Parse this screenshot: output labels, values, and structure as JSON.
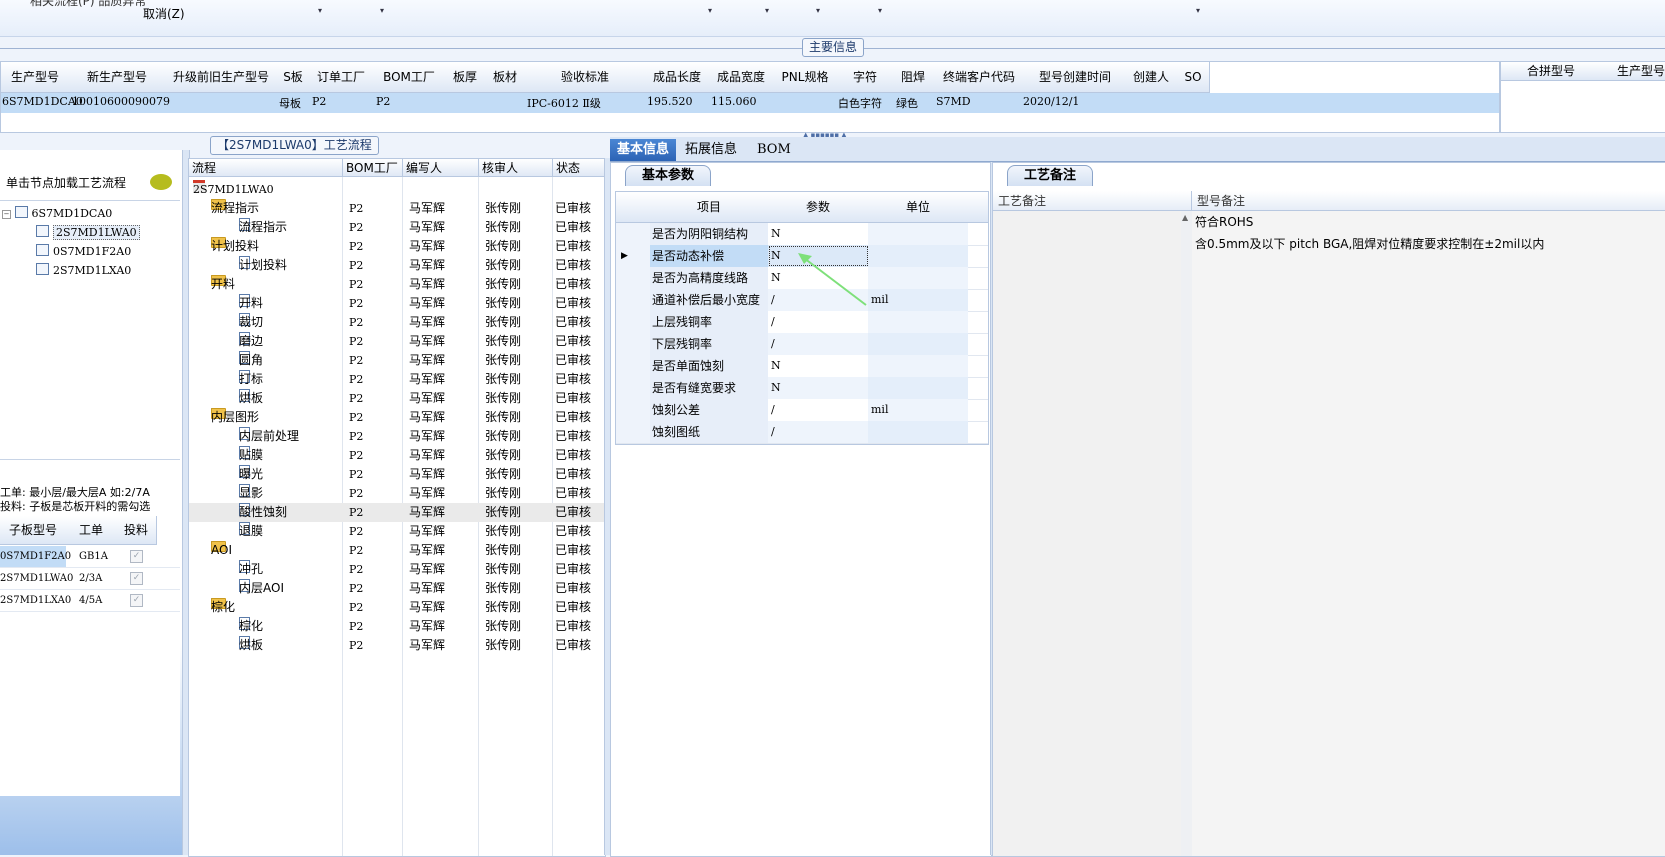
{
  "toolbar": {
    "cut_label": "相关流程(P)  品质异常",
    "cancel_label": "取消(Z)",
    "dropdown_glyph": "▾"
  },
  "main_info": {
    "title": "主要信息",
    "columns": [
      "生产型号",
      "新生产型号",
      "升级前旧生产型号",
      "S板",
      "订单工厂",
      "BOM工厂",
      "板厚",
      "板材",
      "验收标准",
      "成品长度",
      "成品宽度",
      "PNL规格",
      "字符",
      "阻焊",
      "终端客户代码",
      "型号创建时间",
      "创建人",
      "SO"
    ],
    "row": {
      "production_model": "6S7MD1DCA0",
      "new_production_model": "10010600090079",
      "old_production_model": "",
      "s_board": "母板",
      "order_factory": "P2",
      "bom_factory": "P2",
      "thickness": "",
      "material": "",
      "acceptance_standard": "IPC-6012 Ⅱ级",
      "length": "195.520",
      "width": "115.060",
      "pnl_spec": "",
      "character": "白色字符",
      "solder_mask": "绿色",
      "customer_code": "S7MD",
      "create_time": "2020/12/1",
      "creator": "",
      "so": ""
    },
    "merge_columns": [
      "合拼型号",
      "生产型号"
    ]
  },
  "left_panel": {
    "hint": "单击节点加载工艺流程",
    "tree": [
      {
        "label": "6S7MD1DCA0",
        "level": 0
      },
      {
        "label": "2S7MD1LWA0",
        "level": 1,
        "selected": true
      },
      {
        "label": "0S7MD1F2A0",
        "level": 1
      },
      {
        "label": "2S7MD1LXA0",
        "level": 1
      }
    ],
    "note_line1": "工单: 最小层/最大层A 如:2/7A",
    "note_line2": "投料: 子板是芯板开料的需勾选",
    "sub_columns": [
      "子板型号",
      "工单",
      "投料"
    ],
    "sub_rows": [
      {
        "model": "0S7MD1F2A0",
        "order": "GB1A",
        "feed": true
      },
      {
        "model": "2S7MD1LWA0",
        "order": "2/3A",
        "feed": true
      },
      {
        "model": "2S7MD1LXA0",
        "order": "4/5A",
        "feed": true
      }
    ]
  },
  "process": {
    "title": "【2S7MD1LWA0】工艺流程",
    "columns": [
      "流程",
      "BOM工厂",
      "编写人",
      "核审人",
      "状态"
    ],
    "root": "2S7MD1LWA0",
    "rows": [
      {
        "name": "流程指示",
        "type": "folder",
        "bom": "P2",
        "writer": "马军辉",
        "reviewer": "张传刚",
        "status": "已审核"
      },
      {
        "name": "流程指示",
        "type": "doc",
        "bom": "P2",
        "writer": "马军辉",
        "reviewer": "张传刚",
        "status": "已审核"
      },
      {
        "name": "计划投料",
        "type": "folder",
        "bom": "P2",
        "writer": "马军辉",
        "reviewer": "张传刚",
        "status": "已审核"
      },
      {
        "name": "计划投料",
        "type": "doc",
        "bom": "P2",
        "writer": "马军辉",
        "reviewer": "张传刚",
        "status": "已审核"
      },
      {
        "name": "开料",
        "type": "folder",
        "bom": "P2",
        "writer": "马军辉",
        "reviewer": "张传刚",
        "status": "已审核"
      },
      {
        "name": "开料",
        "type": "doc",
        "bom": "P2",
        "writer": "马军辉",
        "reviewer": "张传刚",
        "status": "已审核"
      },
      {
        "name": "裁切",
        "type": "doc",
        "bom": "P2",
        "writer": "马军辉",
        "reviewer": "张传刚",
        "status": "已审核"
      },
      {
        "name": "磨边",
        "type": "doc",
        "bom": "P2",
        "writer": "马军辉",
        "reviewer": "张传刚",
        "status": "已审核"
      },
      {
        "name": "圆角",
        "type": "doc",
        "bom": "P2",
        "writer": "马军辉",
        "reviewer": "张传刚",
        "status": "已审核"
      },
      {
        "name": "打标",
        "type": "doc",
        "bom": "P2",
        "writer": "马军辉",
        "reviewer": "张传刚",
        "status": "已审核"
      },
      {
        "name": "烘板",
        "type": "doc",
        "bom": "P2",
        "writer": "马军辉",
        "reviewer": "张传刚",
        "status": "已审核"
      },
      {
        "name": "内层图形",
        "type": "folder",
        "bom": "P2",
        "writer": "马军辉",
        "reviewer": "张传刚",
        "status": "已审核"
      },
      {
        "name": "内层前处理",
        "type": "doc",
        "bom": "P2",
        "writer": "马军辉",
        "reviewer": "张传刚",
        "status": "已审核"
      },
      {
        "name": "贴膜",
        "type": "doc",
        "bom": "P2",
        "writer": "马军辉",
        "reviewer": "张传刚",
        "status": "已审核"
      },
      {
        "name": "曝光",
        "type": "doc",
        "bom": "P2",
        "writer": "马军辉",
        "reviewer": "张传刚",
        "status": "已审核"
      },
      {
        "name": "显影",
        "type": "doc",
        "bom": "P2",
        "writer": "马军辉",
        "reviewer": "张传刚",
        "status": "已审核"
      },
      {
        "name": "酸性蚀刻",
        "type": "doc",
        "bom": "P2",
        "writer": "马军辉",
        "reviewer": "张传刚",
        "status": "已审核",
        "highlight": true
      },
      {
        "name": "退膜",
        "type": "doc",
        "bom": "P2",
        "writer": "马军辉",
        "reviewer": "张传刚",
        "status": "已审核"
      },
      {
        "name": "AOI",
        "type": "folder",
        "bom": "P2",
        "writer": "马军辉",
        "reviewer": "张传刚",
        "status": "已审核"
      },
      {
        "name": "冲孔",
        "type": "doc",
        "bom": "P2",
        "writer": "马军辉",
        "reviewer": "张传刚",
        "status": "已审核"
      },
      {
        "name": "内层AOI",
        "type": "doc",
        "bom": "P2",
        "writer": "马军辉",
        "reviewer": "张传刚",
        "status": "已审核"
      },
      {
        "name": "棕化",
        "type": "folder",
        "bom": "P2",
        "writer": "马军辉",
        "reviewer": "张传刚",
        "status": "已审核"
      },
      {
        "name": "棕化",
        "type": "doc",
        "bom": "P2",
        "writer": "马军辉",
        "reviewer": "张传刚",
        "status": "已审核"
      },
      {
        "name": "烘板",
        "type": "doc",
        "bom": "P2",
        "writer": "马军辉",
        "reviewer": "张传刚",
        "status": "已审核"
      }
    ]
  },
  "tabs": [
    "基本信息",
    "拓展信息",
    "BOM"
  ],
  "basic_params": {
    "group_title": "基本参数",
    "columns": [
      "项目",
      "参数",
      "单位"
    ],
    "rows": [
      {
        "item": "是否为阴阳铜结构",
        "value": "N",
        "unit": ""
      },
      {
        "item": "是否动态补偿",
        "value": "N",
        "unit": "",
        "current": true
      },
      {
        "item": "是否为高精度线路",
        "value": "N",
        "unit": ""
      },
      {
        "item": "通道补偿后最小宽度",
        "value": "/",
        "unit": "mil"
      },
      {
        "item": "上层残铜率",
        "value": "/",
        "unit": ""
      },
      {
        "item": "下层残铜率",
        "value": "/",
        "unit": ""
      },
      {
        "item": "是否单面蚀刻",
        "value": "N",
        "unit": ""
      },
      {
        "item": "是否有缝宽要求",
        "value": "N",
        "unit": ""
      },
      {
        "item": "蚀刻公差",
        "value": "/",
        "unit": "mil"
      },
      {
        "item": "蚀刻图纸",
        "value": "/",
        "unit": ""
      }
    ]
  },
  "notes": {
    "group_title": "工艺备注",
    "col_process": "工艺备注",
    "col_model": "型号备注",
    "lines": [
      "符合ROHS",
      "含0.5mm及以下 pitch BGA,阻焊对位精度要求控制在±2mil以内"
    ]
  },
  "colors": {
    "selected_row": "#c2dcf6",
    "tab_active": "#2c63b5",
    "folder": "#f0c24a",
    "arrow": "#7ee07a"
  }
}
